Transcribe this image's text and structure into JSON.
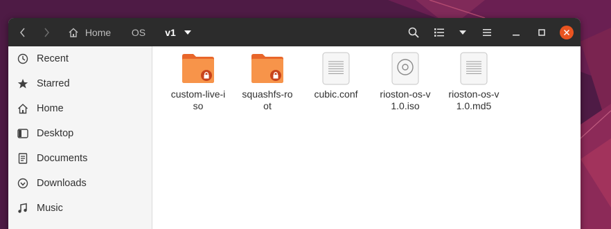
{
  "header": {
    "breadcrumbs": [
      "Home",
      "OS",
      "v1"
    ]
  },
  "sidebar": {
    "items": [
      {
        "label": "Recent",
        "icon": "clock-icon"
      },
      {
        "label": "Starred",
        "icon": "star-icon"
      },
      {
        "label": "Home",
        "icon": "home-icon"
      },
      {
        "label": "Desktop",
        "icon": "desktop-icon"
      },
      {
        "label": "Documents",
        "icon": "documents-icon"
      },
      {
        "label": "Downloads",
        "icon": "download-icon"
      },
      {
        "label": "Music",
        "icon": "music-icon"
      }
    ]
  },
  "files": [
    {
      "name": "custom-live-iso",
      "type": "folder-locked"
    },
    {
      "name": "squashfs-root",
      "type": "folder-locked"
    },
    {
      "name": "cubic.conf",
      "type": "text"
    },
    {
      "name": "rioston-os-v1.0.iso",
      "type": "disc-image"
    },
    {
      "name": "rioston-os-v1.0.md5",
      "type": "text"
    }
  ],
  "colors": {
    "headerbar": "#2c2c2c",
    "close_button": "#e95420",
    "folder": "#f07f3c",
    "wallpaper": "#5a1d4a"
  }
}
